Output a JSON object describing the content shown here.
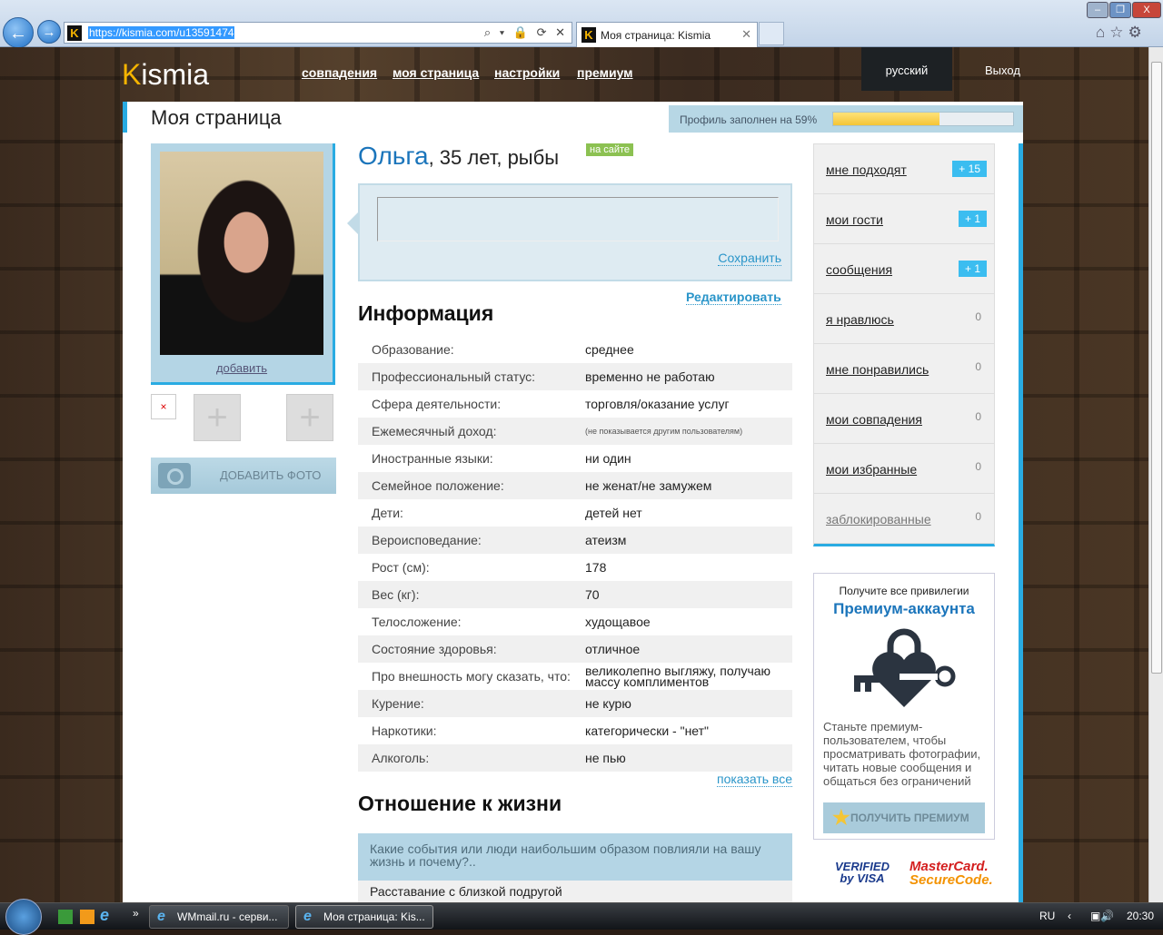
{
  "browser": {
    "url": "https://kismia.com/u13591474",
    "tab_title": "Моя страница: Kismia",
    "address_tools": "⌕ ▾ 🔒 ⟳ ✕"
  },
  "site": {
    "logo_k": "K",
    "logo_rest": "ismia",
    "nav": [
      "совпадения",
      "моя страница",
      "настройки",
      "премиум"
    ],
    "language": "русский",
    "logout": "Выход"
  },
  "page_title": "Моя страница",
  "profile_progress": {
    "label": "Профиль заполнен на 59%",
    "percent": 59
  },
  "photo": {
    "add_link": "добавить",
    "add_photo_button": "ДОБАВИТЬ ФОТО",
    "broken_icon": "×",
    "plus": "+"
  },
  "profile": {
    "name": "Ольга",
    "details": ", 35 лет, рыбы",
    "online_badge": "на сайте",
    "save_link": "Сохранить",
    "edit_link": "Редактировать"
  },
  "info": {
    "heading": "Информация",
    "rows": [
      {
        "label": "Образование:",
        "value": "среднее"
      },
      {
        "label": "Профессиональный статус:",
        "value": "временно не работаю"
      },
      {
        "label": "Сфера деятельности:",
        "value": "торговля/оказание услуг"
      },
      {
        "label": "Ежемесячный доход:",
        "value": "(не показывается другим пользователям)"
      },
      {
        "label": "Иностранные языки:",
        "value": "ни один"
      },
      {
        "label": "Семейное положение:",
        "value": "не женат/не замужем"
      },
      {
        "label": "Дети:",
        "value": "детей нет"
      },
      {
        "label": "Вероисповедание:",
        "value": "атеизм"
      },
      {
        "label": "Рост (см):",
        "value": "178"
      },
      {
        "label": "Вес (кг):",
        "value": "70"
      },
      {
        "label": "Телосложение:",
        "value": "худощавое"
      },
      {
        "label": "Состояние здоровья:",
        "value": "отличное"
      },
      {
        "label": "Про внешность могу сказать, что:",
        "value": "великолепно выгляжу, получаю массу комплиментов"
      },
      {
        "label": "Курение:",
        "value": "не курю"
      },
      {
        "label": "Наркотики:",
        "value": "категорически - \"нет\""
      },
      {
        "label": "Алкоголь:",
        "value": "не пью"
      }
    ],
    "show_all": "показать все"
  },
  "life": {
    "heading": "Отношение к жизни",
    "question": "Какие события или люди наибольшим образом повлияли на вашу жизнь и почему?..",
    "answer": "Расставание с близкой подругой"
  },
  "menu": [
    {
      "label": "мне подходят",
      "count": "+ 15",
      "badge": true
    },
    {
      "label": "мои гости",
      "count": "+ 1",
      "badge": true
    },
    {
      "label": "сообщения",
      "count": "+ 1",
      "badge": true
    },
    {
      "label": "я нравлюсь",
      "count": "0",
      "badge": false
    },
    {
      "label": "мне понравились",
      "count": "0",
      "badge": false
    },
    {
      "label": "мои совпадения",
      "count": "0",
      "badge": false
    },
    {
      "label": "мои избранные",
      "count": "0",
      "badge": false
    },
    {
      "label": "заблокированные",
      "count": "0",
      "badge": false
    }
  ],
  "premium": {
    "line1": "Получите все привилегии",
    "line2": "Премиум-аккаунта",
    "text": "Станьте премиум-пользователем, чтобы просматривать фотографии, читать новые сообщения и общаться без ограничений",
    "button": "ПОЛУЧИТЬ ПРЕМИУМ"
  },
  "payment": {
    "visa1": "VERIFIED",
    "visa2": "by VISA",
    "mc1": "MasterCard.",
    "mc2": "SecureCode."
  },
  "taskbar": {
    "tasks": [
      "WMmail.ru - серви...",
      "Моя страница: Kis..."
    ],
    "lang": "RU",
    "time": "20:30"
  }
}
